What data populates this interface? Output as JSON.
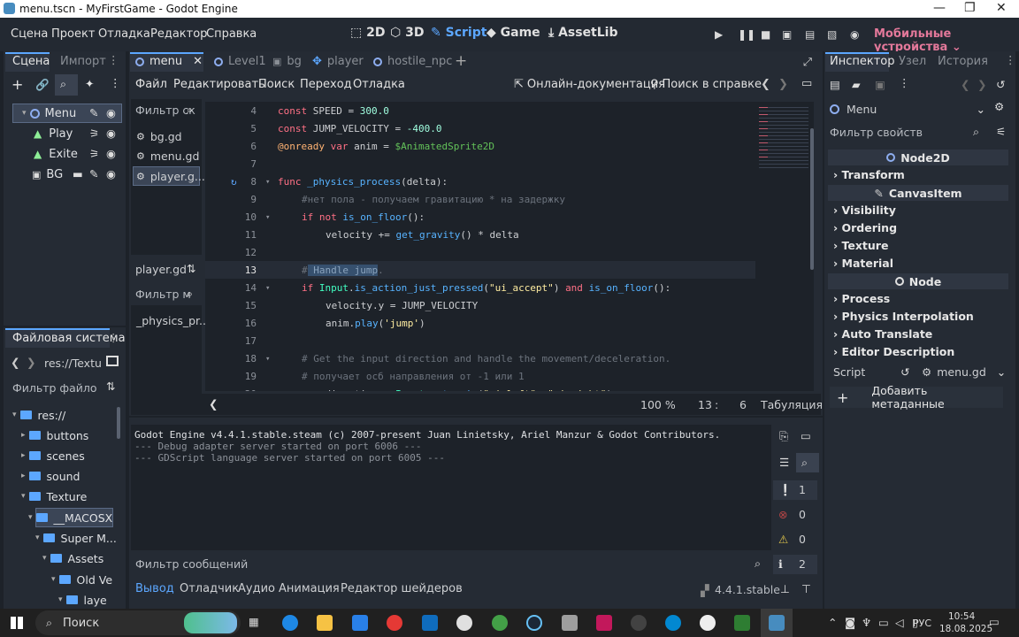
{
  "window": {
    "title": "menu.tscn - MyFirstGame - Godot Engine"
  },
  "main_menu": [
    "Сцена",
    "Проект",
    "Отладка",
    "Редактор",
    "Справка"
  ],
  "workspaces": [
    "2D",
    "3D",
    "Script",
    "Game",
    "AssetLib"
  ],
  "renderer": "Мобильные устройства",
  "scene_panel": {
    "tabs": [
      "Сцена",
      "Импорт"
    ]
  },
  "scene_tree": [
    {
      "name": "Menu"
    },
    {
      "name": "Play"
    },
    {
      "name": "Exite"
    },
    {
      "name": "BG"
    }
  ],
  "filesystem": {
    "title": "Файловая система",
    "path": "res://Textu",
    "filter": "Фильтр файло",
    "items": [
      "res://",
      "buttons",
      "scenes",
      "sound",
      "Texture",
      "__MACOSX",
      "Super M...",
      "Assets",
      "Old Ve",
      "laye"
    ]
  },
  "script_tabs": [
    "menu",
    "Level1",
    "bg",
    "player",
    "hostile_npc"
  ],
  "script_menu": [
    "Файл",
    "Редактировать",
    "Поиск",
    "Переход",
    "Отладка"
  ],
  "online_docs": "Онлайн-документация",
  "help_search": "Поиск в справке",
  "scripts_filter": "Фильтр ск",
  "scripts_list": [
    "bg.gd",
    "menu.gd",
    "player.g..."
  ],
  "current_script": "player.gd",
  "methods_filter": "Фильтр м",
  "methods_list": [
    "_physics_pr..."
  ],
  "code": {
    "line_numbers": [
      "4",
      "5",
      "6",
      "7",
      "8",
      "9",
      "10",
      "11",
      "12",
      "13",
      "14",
      "15",
      "16",
      "17",
      "18",
      "19",
      "20"
    ]
  },
  "status": {
    "zoom": "100 %",
    "line": "13",
    "sep": ":",
    "col": "6",
    "indent": "Табуляция"
  },
  "output": {
    "lines": [
      "Godot Engine v4.4.1.stable.steam (c) 2007-present Juan Linietsky, Ariel Manzur & Godot Contributors.",
      "--- Debug adapter server started on port 6006 ---",
      "--- GDScript language server started on port 6005 ---"
    ],
    "filter": "Фильтр сообщений",
    "counts": [
      "1",
      "0",
      "0",
      "2"
    ]
  },
  "bottom_tabs": [
    "Вывод",
    "Отладчик",
    "Аудио",
    "Анимация",
    "Редактор шейдеров"
  ],
  "version": "4.4.1.stable",
  "inspector": {
    "tabs": [
      "Инспектор",
      "Узел",
      "История"
    ],
    "node": "Menu",
    "filter": "Фильтр свойств",
    "class1": "Node2D",
    "transform": "Transform",
    "class2": "CanvasItem",
    "sections1": [
      "Visibility",
      "Ordering",
      "Texture",
      "Material"
    ],
    "class3": "Node",
    "sections2": [
      "Process",
      "Physics Interpolation",
      "Auto Translate",
      "Editor Description"
    ],
    "script_label": "Script",
    "script_value": "menu.gd",
    "add_meta": "Добавить метаданные"
  },
  "taskbar": {
    "search": "Поиск",
    "lang": "РУС",
    "time": "10:54",
    "date": "18.08.2025"
  }
}
